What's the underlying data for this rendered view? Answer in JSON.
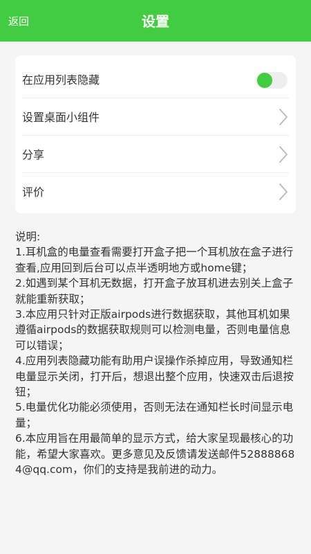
{
  "header": {
    "back_label": "返回",
    "title": "设置"
  },
  "colors": {
    "accent": "#41cc41",
    "toggle_track": "#eeeeee"
  },
  "settings": {
    "items": [
      {
        "label": "在应用列表隐藏",
        "control": "toggle",
        "toggle_on": true
      },
      {
        "label": "设置桌面小组件",
        "control": "chevron-right-icon"
      },
      {
        "label": "分享",
        "control": "chevron-right-icon"
      },
      {
        "label": "评价",
        "control": "chevron-right-icon"
      }
    ]
  },
  "description": {
    "heading": "说明:",
    "lines": [
      " 1.耳机盒的电量查看需要打开盒子把一个耳机放在盒子进行查看,应用回到后台可以点半透明地方或home键；",
      " 2.如遇到某个耳机无数据，打开盒子放耳机进去别关上盒子就能重新获取；",
      " 3.本应用只针对正版airpods进行数据获取，其他耳机如果遵循airpods的数据获取规则可以检测电量，否则电量信息可以错误；",
      " 4.应用列表隐藏功能有助用户误操作杀掉应用，导致通知栏电量显示关闭，打开后，想退出整个应用，快速双击后退按钮；",
      " 5.电量优化功能必须使用，否则无法在通知栏长时间显示电量；",
      " 6.本应用旨在用最简单的显示方式，给大家呈现最核心的功能，希望大家喜欢。更多意见及反馈请发送邮件528888684@qq.com，你们的支持是我前进的动力。"
    ]
  }
}
